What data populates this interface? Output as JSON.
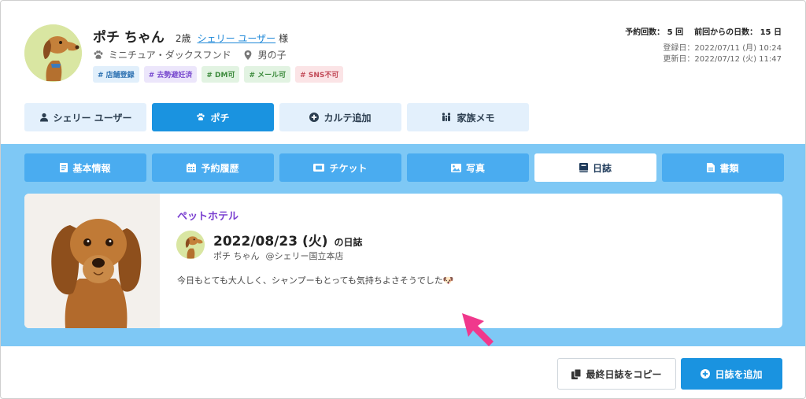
{
  "pet": {
    "name": "ポチ ちゃん",
    "age": "2歳",
    "owner_link": "シェリー ユーザー",
    "honorific": "様",
    "breed": "ミニチュア・ダックスフンド",
    "gender": "男の子"
  },
  "tags": [
    {
      "label": "# 店舗登録",
      "color": "#2a6fb0"
    },
    {
      "label": "# 去勢避妊済",
      "color": "#7a4ccf"
    },
    {
      "label": "# DM可",
      "color": "#3c8a3c"
    },
    {
      "label": "# メール可",
      "color": "#3c8a3c"
    },
    {
      "label": "# SNS不可",
      "color": "#c24a58"
    }
  ],
  "stats": {
    "booking_count": "予約回数： 5 回",
    "days_since": "前回からの日数： 15 日",
    "registered": "登録日：2022/07/11 (月) 10:24",
    "updated": "更新日：2022/07/12 (火) 11:47"
  },
  "top_tabs": [
    {
      "label": "シェリー ユーザー",
      "icon": "user-icon"
    },
    {
      "label": "ポチ",
      "icon": "paw-icon"
    },
    {
      "label": "カルテ追加",
      "icon": "plus-circle-icon"
    },
    {
      "label": "家族メモ",
      "icon": "family-icon"
    }
  ],
  "sub_tabs": [
    {
      "label": "基本情報",
      "icon": "document-icon"
    },
    {
      "label": "予約履歴",
      "icon": "calendar-icon"
    },
    {
      "label": "チケット",
      "icon": "ticket-icon"
    },
    {
      "label": "写真",
      "icon": "image-icon"
    },
    {
      "label": "日誌",
      "icon": "book-icon"
    },
    {
      "label": "書類",
      "icon": "file-icon"
    }
  ],
  "diary": {
    "category": "ペットホテル",
    "date": "2022/08/23 (火)",
    "suffix": "の日誌",
    "pet": "ポチ ちゃん",
    "store": "@シェリー国立本店",
    "body": "今日もとても大人しく、シャンプーもとっても気持ちよさそうでした🐶"
  },
  "buttons": {
    "copy_last": "最終日誌をコピー",
    "add_diary": "日誌を追加"
  },
  "colors": {
    "accent": "#1a93e0",
    "panel": "#7ec8f5",
    "sub_tab": "#4aacf0",
    "category": "#7a3fd0",
    "cursor": "#f0388c"
  }
}
